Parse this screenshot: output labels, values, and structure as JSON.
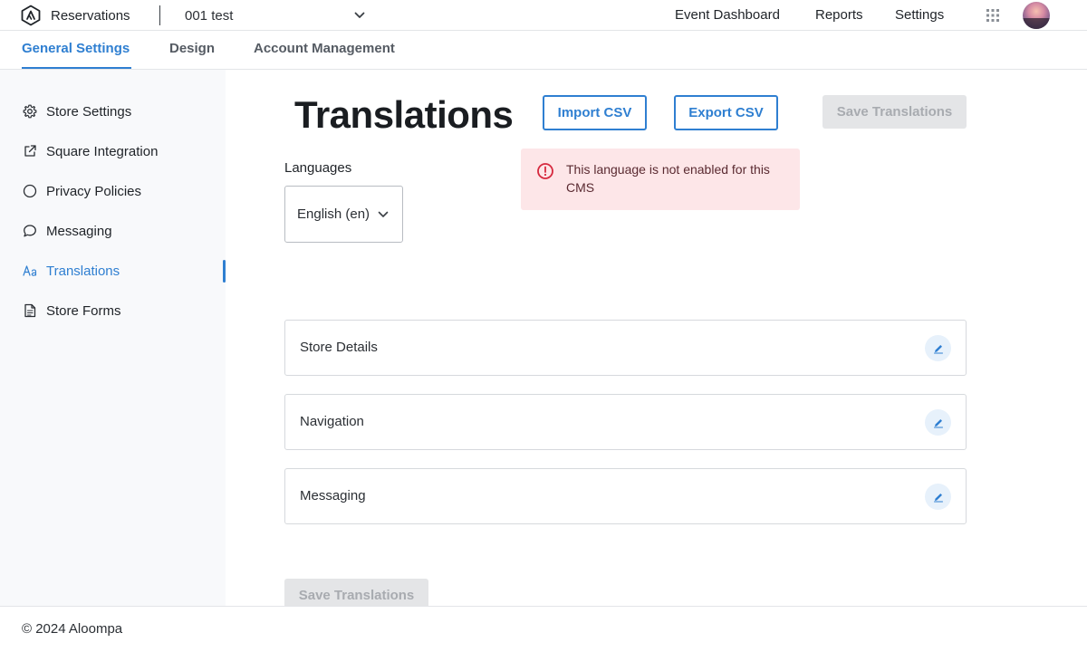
{
  "app": {
    "name": "Reservations",
    "store_selector": "001 test"
  },
  "topnav": {
    "event_dashboard": "Event Dashboard",
    "reports": "Reports",
    "settings": "Settings"
  },
  "tabs": [
    {
      "label": "General Settings",
      "active": true
    },
    {
      "label": "Design",
      "active": false
    },
    {
      "label": "Account Management",
      "active": false
    }
  ],
  "sidebar": {
    "items": [
      {
        "label": "Store Settings",
        "icon": "gear-icon"
      },
      {
        "label": "Square Integration",
        "icon": "external-link-icon"
      },
      {
        "label": "Privacy Policies",
        "icon": "circle-icon"
      },
      {
        "label": "Messaging",
        "icon": "chat-bubble-icon"
      },
      {
        "label": "Translations",
        "icon": "text-aa-icon",
        "active": true
      },
      {
        "label": "Store Forms",
        "icon": "document-icon"
      }
    ]
  },
  "main": {
    "title": "Translations",
    "import_label": "Import CSV",
    "export_label": "Export CSV",
    "save_label": "Save Translations",
    "languages_label": "Languages",
    "language_selected": "English (en)",
    "alert_text": "This language is not enabled for this CMS",
    "sections": [
      {
        "label": "Store Details"
      },
      {
        "label": "Navigation"
      },
      {
        "label": "Messaging"
      }
    ],
    "save_bottom_label": "Save Translations"
  },
  "footer": {
    "copyright": "© 2024 Aloompa"
  },
  "colors": {
    "accent": "#2f7fd1",
    "alert_bg": "#fde6e8",
    "alert_icon": "#d6293e",
    "sidebar_bg": "#f8f9fb",
    "disabled_bg": "#e4e5e7"
  }
}
